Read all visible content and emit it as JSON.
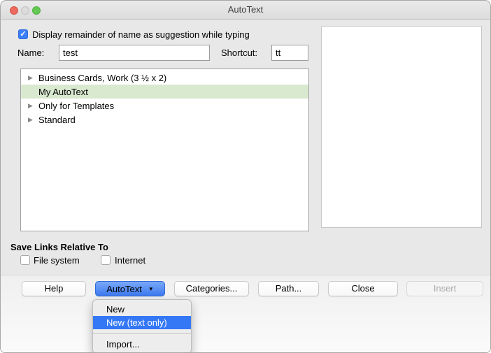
{
  "window": {
    "title": "AutoText"
  },
  "titlebar": {
    "close_light": "close",
    "minimize_light": "minimize-disabled",
    "zoom_light": "zoom"
  },
  "icons": {
    "checkmark": "✓",
    "expand_arrow": "▶",
    "dropdown_arrow": "▼"
  },
  "suggestion_checkbox": {
    "label": "Display remainder of name as suggestion while typing",
    "checked": true
  },
  "name_field": {
    "label": "Name:",
    "value": "test"
  },
  "shortcut_field": {
    "label": "Shortcut:",
    "value": "tt"
  },
  "tree": {
    "items": [
      {
        "label": "Business Cards, Work (3 ½ x 2)",
        "expandable": true,
        "selected": false
      },
      {
        "label": "My AutoText",
        "expandable": false,
        "selected": true
      },
      {
        "label": "Only for Templates",
        "expandable": true,
        "selected": false
      },
      {
        "label": "Standard",
        "expandable": true,
        "selected": false
      }
    ]
  },
  "preview": {
    "content": ""
  },
  "save_links": {
    "title": "Save Links Relative To",
    "options": [
      {
        "label": "File system",
        "checked": false
      },
      {
        "label": "Internet",
        "checked": false
      }
    ]
  },
  "buttons": {
    "help": "Help",
    "autotext": "AutoText",
    "categories": "Categories...",
    "path": "Path...",
    "close": "Close",
    "insert": "Insert"
  },
  "menu": {
    "items": [
      {
        "label": "New"
      },
      {
        "label": "New (text only)"
      },
      {
        "label": "Import..."
      }
    ],
    "highlighted": "New (text only)"
  },
  "colors": {
    "accent_blue": "#3478f6",
    "selection_green": "#d9e9d0",
    "checkbox_blue": "#3b7ef7",
    "traffic_red": "#ed6a5e",
    "traffic_green": "#64c953",
    "dialog_bg": "#e8e8e8"
  }
}
